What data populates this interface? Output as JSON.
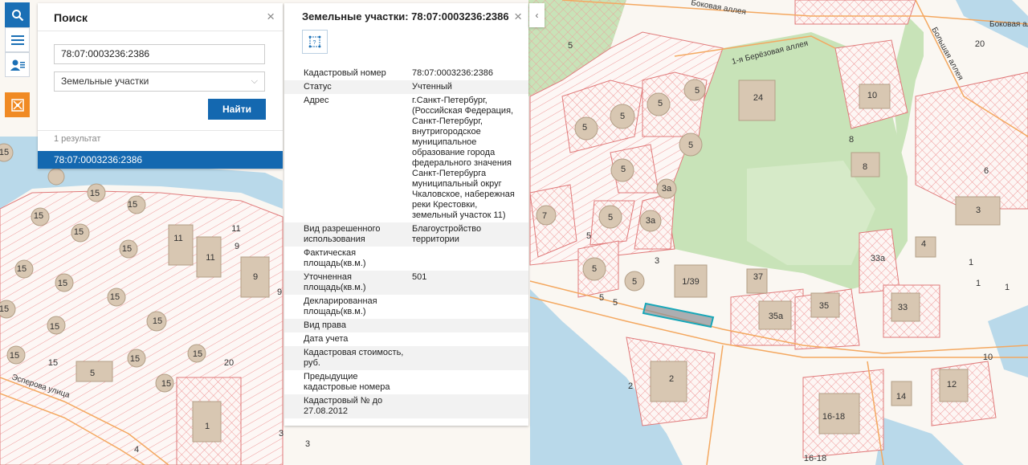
{
  "toolbar": {
    "buttons": [
      {
        "name": "search-icon",
        "glyph": "⚲"
      },
      {
        "name": "menu-icon",
        "glyph": "☰"
      },
      {
        "name": "user-list-icon",
        "glyph": "👤"
      },
      {
        "name": "emblem-icon",
        "glyph": "✱"
      }
    ]
  },
  "search": {
    "title": "Поиск",
    "query_value": "78:07:0003236:2386",
    "type_value": "Земельные участки",
    "find_label": "Найти",
    "results_count": "1 результат",
    "result_item": "78:07:0003236:2386",
    "close": "×"
  },
  "info": {
    "title": "Земельные участки: 78:07:0003236:2386",
    "close": "×",
    "collapse": "‹",
    "properties": [
      {
        "key": "Кадастровый номер",
        "value": "78:07:0003236:2386"
      },
      {
        "key": "Статус",
        "value": "Учтенный"
      },
      {
        "key": "Адрес",
        "value": "г.Санкт-Петербург, (Российская Федерация, Санкт-Петербург, внутригородское муниципальное образование города федерального значения Санкт-Петербурга муниципальный округ Чкаловское, набережная реки Крестовки, земельный участок 11)"
      },
      {
        "key": "Вид разрешенного использования",
        "value": "Благоустройство территории"
      },
      {
        "key": "Фактическая площадь(кв.м.)",
        "value": ""
      },
      {
        "key": "Уточненная площадь(кв.м.)",
        "value": "501"
      },
      {
        "key": "Декларированная площадь(кв.м.)",
        "value": ""
      },
      {
        "key": "Вид права",
        "value": ""
      },
      {
        "key": "Дата учета",
        "value": ""
      },
      {
        "key": "Кадастровая стоимость, руб.",
        "value": ""
      },
      {
        "key": "Предыдущие кадастровые номера",
        "value": ""
      },
      {
        "key": "Кадастровый № до 27.08.2012",
        "value": ""
      }
    ]
  },
  "map": {
    "streets": [
      "Боковая аллея",
      "Большая аллея",
      "Боковая аллея",
      "1-я Берёзовая аллея",
      "Эсперова улица"
    ],
    "labels": [
      "15",
      "15",
      "15",
      "15",
      "15",
      "15",
      "15",
      "15",
      "15",
      "15",
      "15",
      "15",
      "15",
      "15",
      "15",
      "15",
      "15",
      "11",
      "11",
      "11",
      "9",
      "9",
      "9",
      "20",
      "5",
      "1",
      "3",
      "3",
      "4",
      "7",
      "5",
      "5",
      "5",
      "5",
      "5",
      "5",
      "5",
      "5",
      "5",
      "5",
      "3а",
      "3а",
      "5",
      "5",
      "5",
      "3",
      "1/39",
      "37",
      "35а",
      "35",
      "33",
      "33а",
      "4",
      "3",
      "6",
      "1",
      "1",
      "1",
      "24",
      "10",
      "8",
      "8",
      "20",
      "2",
      "2",
      "14",
      "12",
      "16-18",
      "16-18",
      "10"
    ]
  },
  "colors": {
    "accent": "#1468b0",
    "emblem": "#f08a24",
    "plot_stroke": "#e07a7a",
    "water": "#b9d9ea",
    "green": "#c8e3b8"
  }
}
